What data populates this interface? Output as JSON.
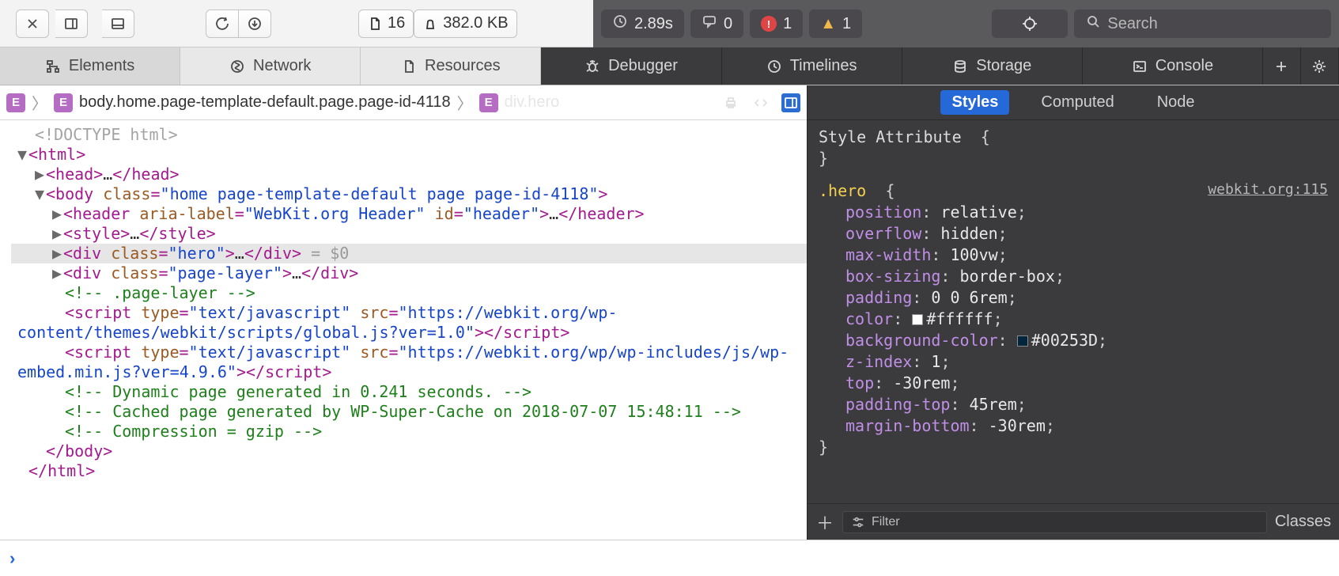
{
  "toolbar": {
    "docCount": "16",
    "transferSize": "382.0 KB",
    "loadTime": "2.89s",
    "issues": "0",
    "errors": "1",
    "warnings": "1",
    "searchPlaceholder": "Search"
  },
  "tabs": {
    "elements": "Elements",
    "network": "Network",
    "resources": "Resources",
    "debugger": "Debugger",
    "timelines": "Timelines",
    "storage": "Storage",
    "console": "Console"
  },
  "breadcrumb": {
    "chip1": "E",
    "chip2": "E",
    "path1": "body.home.page-template-default.page.page-id-4118",
    "chip3": "E",
    "path2": "div.hero"
  },
  "dom": {
    "doctype": "<!DOCTYPE html>",
    "bodyClass": "home page-template-default page page-id-4118",
    "headerAriaLabel": "WebKit.org Header",
    "headerId": "header",
    "heroClass": "hero",
    "auxSelected": "= $0",
    "pageLayerClass": "page-layer",
    "commentPageLayer": "<!-- .page-layer -->",
    "scriptType": "text/javascript",
    "script1Src": "https://webkit.org/wp-content/themes/webkit/scripts/global.js?ver=1.0",
    "script2Src": "https://webkit.org/wp/wp-includes/js/wp-embed.min.js?ver=4.9.6",
    "commentDynamic": "<!-- Dynamic page generated in 0.241 seconds. -->",
    "commentCached": "<!-- Cached page generated by WP-Super-Cache on 2018-07-07 15:48:11 -->",
    "commentGzip": "<!-- Compression = gzip -->"
  },
  "styles": {
    "tabs": {
      "styles": "Styles",
      "computed": "Computed",
      "node": "Node"
    },
    "styleAttrLabel": "Style Attribute",
    "styleAttrOpen": "{",
    "styleAttrClose": "}",
    "heroSelector": ".hero",
    "heroOrigin": "webkit.org:115",
    "colorHex": "#ffffff",
    "bgHex": "#00253D",
    "declarations": [
      {
        "name": "position",
        "value": "relative"
      },
      {
        "name": "overflow",
        "value": "hidden"
      },
      {
        "name": "max-width",
        "value": "100vw"
      },
      {
        "name": "box-sizing",
        "value": "border-box"
      },
      {
        "name": "padding",
        "value": "0 0 6rem"
      },
      {
        "name": "color",
        "value": "#ffffff",
        "swatch": "#ffffff"
      },
      {
        "name": "background-color",
        "value": "#00253D",
        "swatch": "#00253D"
      },
      {
        "name": "z-index",
        "value": "1"
      },
      {
        "name": "top",
        "value": "-30rem"
      },
      {
        "name": "padding-top",
        "value": "45rem"
      },
      {
        "name": "margin-bottom",
        "value": "-30rem"
      }
    ],
    "filterPlaceholder": "Filter",
    "classesLabel": "Classes"
  }
}
